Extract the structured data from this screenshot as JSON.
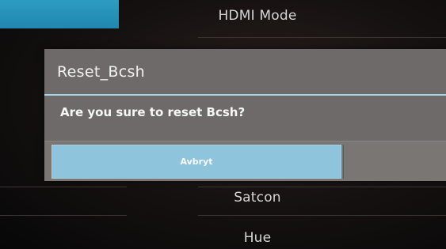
{
  "background_menu": {
    "items": [
      {
        "label": "HDMI Mode"
      },
      {
        "label": "Satcon"
      },
      {
        "label": "Hue"
      }
    ]
  },
  "dialog": {
    "title": "Reset_Bcsh",
    "message": "Are you sure to reset Bcsh?",
    "cancel_label": "Avbryt"
  },
  "colors": {
    "accent": "#8ec4dc",
    "title_rule": "#a9d3e6",
    "dialog_bg": "#6d6a69",
    "tile": "#2d9cc3"
  }
}
